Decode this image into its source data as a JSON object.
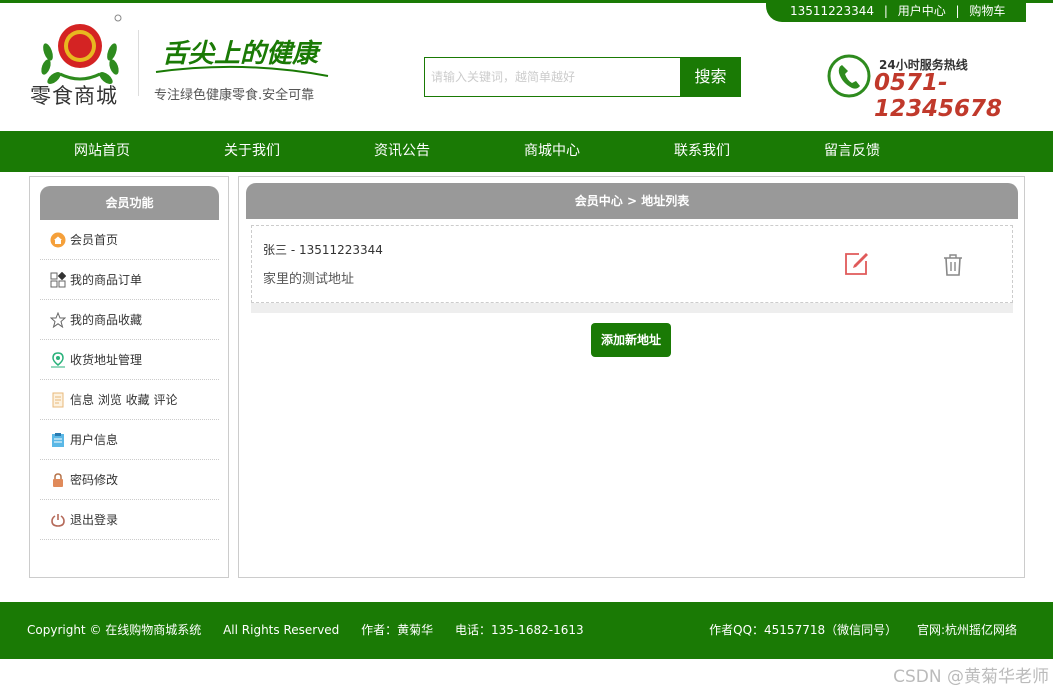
{
  "user_bar": {
    "phone": "13511223344",
    "separator": "|",
    "user_center": "用户中心",
    "cart": "购物车"
  },
  "header": {
    "logo_text": "零食商城",
    "slogan_art": "舌尖上的健康",
    "slogan_sub": "专注绿色健康零食.安全可靠",
    "search_placeholder": "请输入关键词，越简单越好",
    "search_button": "搜索",
    "hotline_label": "24小时服务热线",
    "hotline_number": "0571-12345678"
  },
  "nav": {
    "items": [
      "网站首页",
      "关于我们",
      "资讯公告",
      "商城中心",
      "联系我们",
      "留言反馈"
    ]
  },
  "sidebar": {
    "title": "会员功能",
    "items": [
      {
        "label": "会员首页",
        "icon": "home-circle-icon"
      },
      {
        "label": "我的商品订单",
        "icon": "grid-icon"
      },
      {
        "label": "我的商品收藏",
        "icon": "star-icon"
      },
      {
        "label": "收货地址管理",
        "icon": "location-icon"
      },
      {
        "label": "信息 浏览 收藏 评论",
        "icon": "document-icon"
      },
      {
        "label": "用户信息",
        "icon": "clipboard-icon"
      },
      {
        "label": "密码修改",
        "icon": "lock-icon"
      },
      {
        "label": "退出登录",
        "icon": "power-icon"
      }
    ]
  },
  "main": {
    "breadcrumb": "会员中心 > 地址列表",
    "address": {
      "name_phone": "张三 - 13511223344",
      "detail": "家里的测试地址"
    },
    "add_button": "添加新地址"
  },
  "footer": {
    "copyright": "Copyright © 在线购物商城系统",
    "rights": "All Rights Reserved",
    "author": "作者：黄菊华",
    "phone": "电话：135-1682-1613",
    "qq": "作者QQ：45157718（微信同号）",
    "site": "官网:杭州摇亿网络"
  },
  "watermark": "CSDN @黄菊华老师",
  "colors": {
    "brand_green": "#1a7a05",
    "header_gray": "#999999",
    "hotline_red": "#c0392b"
  }
}
